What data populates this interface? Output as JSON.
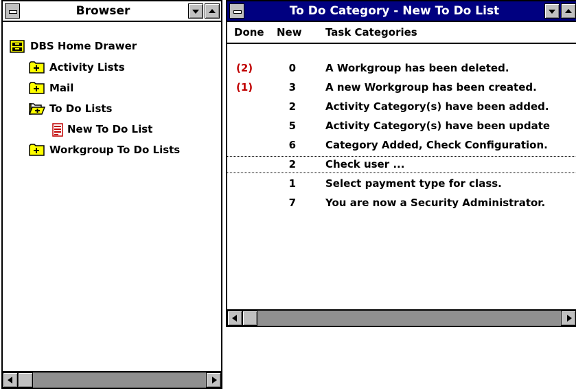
{
  "browser": {
    "title": "Browser",
    "tree": [
      {
        "label": "DBS Home Drawer",
        "icon": "drawer-icon"
      },
      {
        "label": "Activity Lists",
        "icon": "folder-plus-icon"
      },
      {
        "label": "Mail",
        "icon": "folder-plus-icon"
      },
      {
        "label": "To Do Lists",
        "icon": "folder-open-icon"
      },
      {
        "label": "New To Do List",
        "icon": "todo-list-icon"
      },
      {
        "label": "Workgroup To Do Lists",
        "icon": "folder-plus-icon"
      }
    ]
  },
  "todo": {
    "title": "To Do Category - New To Do List",
    "columns": {
      "done": "Done",
      "new": "New",
      "task": "Task Categories"
    },
    "rows": [
      {
        "done": "(2)",
        "new": "0",
        "task": "A Workgroup has been deleted."
      },
      {
        "done": "(1)",
        "new": "3",
        "task": "A new Workgroup has been created."
      },
      {
        "done": "",
        "new": "2",
        "task": "Activity Category(s) have been added."
      },
      {
        "done": "",
        "new": "5",
        "task": "Activity Category(s) have been update"
      },
      {
        "done": "",
        "new": "6",
        "task": "Category Added, Check Configuration."
      },
      {
        "done": "",
        "new": "2",
        "task": "Check user ..."
      },
      {
        "done": "",
        "new": "1",
        "task": "Select payment type for class."
      },
      {
        "done": "",
        "new": "7",
        "task": "You are now a Security Administrator."
      }
    ]
  },
  "colors": {
    "active_title": "#000080",
    "done_count": "#c00000",
    "folder": "#ffff00"
  }
}
